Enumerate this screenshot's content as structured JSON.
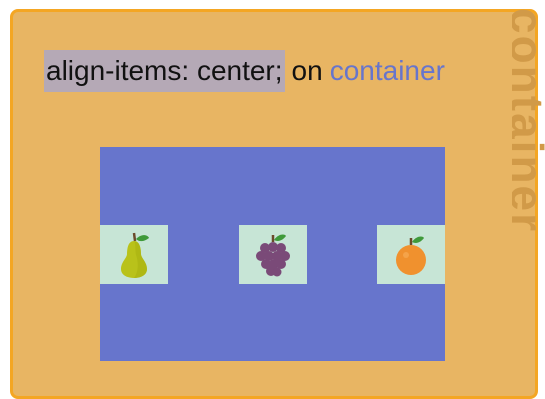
{
  "caption": {
    "code": "align-items: center;",
    "connector": "on",
    "target": "container"
  },
  "edge_text": "container",
  "colors": {
    "card_bg": "#e8b563",
    "card_border": "#f4a623",
    "code_highlight": "#b5a9b6",
    "accent_text": "#6775cc",
    "container_bg": "#6775cc",
    "item_bg": "#c7e5d6"
  },
  "items": [
    {
      "icon": "pear-icon"
    },
    {
      "icon": "grapes-icon"
    },
    {
      "icon": "orange-icon"
    }
  ]
}
